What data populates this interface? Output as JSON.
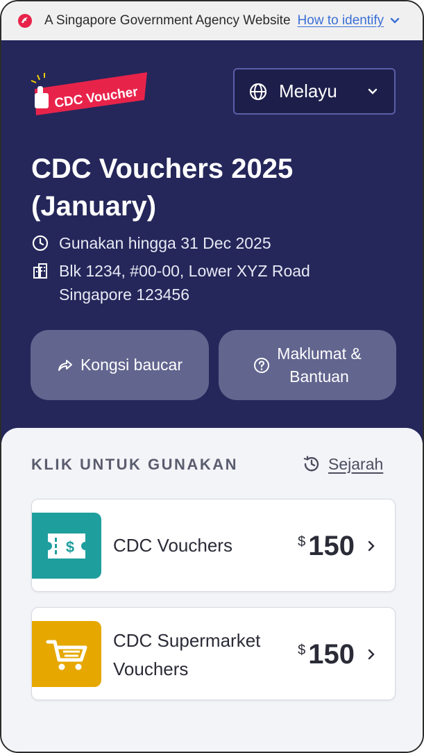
{
  "gov_banner": {
    "text": "A Singapore Government Agency Website",
    "link_label": "How to identify"
  },
  "header": {
    "logo_text": "CDC Voucher",
    "language": "Melayu"
  },
  "hero": {
    "title": "CDC Vouchers 2025 (January)",
    "expiry": "Gunakan hingga 31 Dec 2025",
    "address_line1": "Blk 1234, #00-00, Lower XYZ Road",
    "address_line2": "Singapore 123456",
    "share_label": "Kongsi baucar",
    "help_line1": "Maklumat &",
    "help_line2": "Bantuan"
  },
  "vouchers_section": {
    "heading": "KLIK UNTUK GUNAKAN",
    "history_label": "Sejarah",
    "items": [
      {
        "name_line1": "CDC Vouchers",
        "name_line2": "",
        "currency": "$",
        "amount": "150",
        "icon": "ticket-dollar-icon",
        "tile_color": "#1f9e9e"
      },
      {
        "name_line1": "CDC Supermarket",
        "name_line2": "Vouchers",
        "currency": "$",
        "amount": "150",
        "icon": "shopping-cart-icon",
        "tile_color": "#e6a800"
      }
    ]
  },
  "colors": {
    "hero_bg": "#25275a",
    "button_bg": "#62658e",
    "logo_red": "#e8234a",
    "link_blue": "#3b6fd6"
  }
}
